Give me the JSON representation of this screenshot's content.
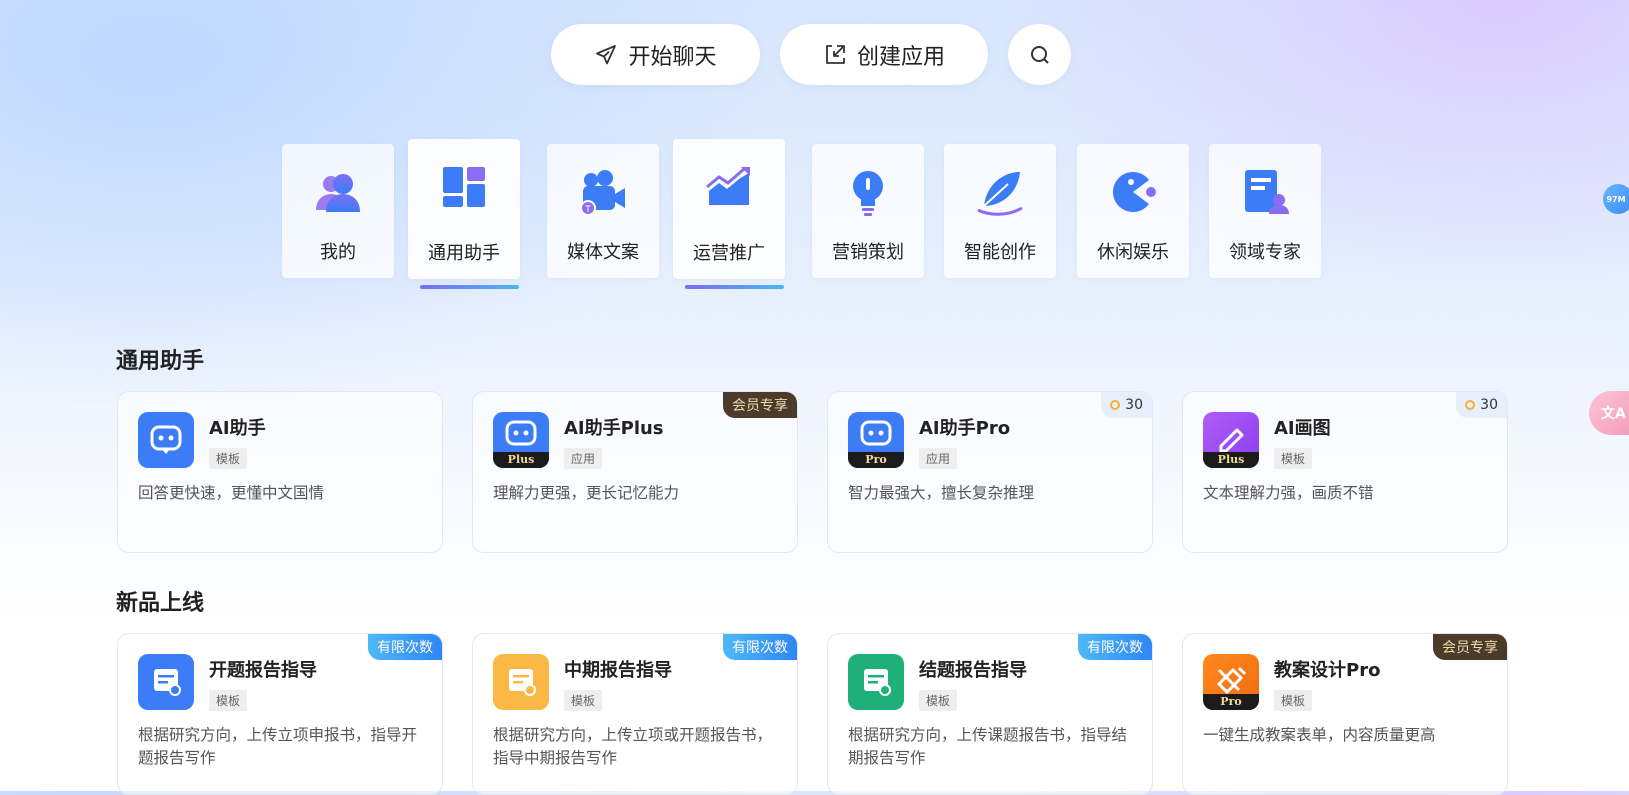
{
  "toolbar": {
    "chat_label": "开始聊天",
    "create_label": "创建应用",
    "chat_icon": "send-icon",
    "create_icon": "import-icon",
    "search_icon": "search-icon"
  },
  "categories": [
    {
      "label": "我的",
      "icon": "users-icon",
      "active": false
    },
    {
      "label": "通用助手",
      "icon": "layout-icon",
      "active": true
    },
    {
      "label": "媒体文案",
      "icon": "video-camera-icon",
      "active": false
    },
    {
      "label": "运营推广",
      "icon": "trend-chart-icon",
      "active": true
    },
    {
      "label": "营销策划",
      "icon": "lightbulb-icon",
      "active": false
    },
    {
      "label": "智能创作",
      "icon": "feather-icon",
      "active": false
    },
    {
      "label": "休闲娱乐",
      "icon": "pacman-icon",
      "active": false
    },
    {
      "label": "领域专家",
      "icon": "expert-document-icon",
      "active": false
    }
  ],
  "sections": [
    {
      "title": "通用助手",
      "cards": [
        {
          "name": "AI助手",
          "tag": "模板",
          "desc": "回答更快速，更懂中文国情",
          "badge": "",
          "icon": "chat-bot-icon",
          "icon_sub": ""
        },
        {
          "name": "AI助手Plus",
          "tag": "应用",
          "desc": "理解力更强，更长记忆能力",
          "badge": "会员专享",
          "icon": "chat-bot-icon",
          "icon_sub": "Plus"
        },
        {
          "name": "AI助手Pro",
          "tag": "应用",
          "desc": "智力最强大，擅长复杂推理",
          "points": "30",
          "icon": "chat-bot-icon",
          "icon_sub": "Pro"
        },
        {
          "name": "AI画图",
          "tag": "模板",
          "desc": "文本理解力强，画质不错",
          "points": "30",
          "icon": "pencil-icon",
          "icon_sub": "Plus"
        }
      ]
    },
    {
      "title": "新品上线",
      "cards": [
        {
          "name": "开题报告指导",
          "tag": "模板",
          "desc": "根据研究方向，上传立项申报书，指导开题报告写作",
          "badge": "有限次数",
          "icon": "report-icon"
        },
        {
          "name": "中期报告指导",
          "tag": "模板",
          "desc": "根据研究方向，上传立项或开题报告书，指导中期报告写作",
          "badge": "有限次数",
          "icon": "report-icon"
        },
        {
          "name": "结题报告指导",
          "tag": "模板",
          "desc": "根据研究方向，上传课题报告书，指导结期报告写作",
          "badge": "有限次数",
          "icon": "report-icon"
        },
        {
          "name": "教案设计Pro",
          "tag": "模板",
          "desc": "一键生成教案表单，内容质量更高",
          "badge": "会员专享",
          "icon": "pencil-ruler-icon",
          "icon_sub": "Pro"
        }
      ]
    }
  ],
  "floating": {
    "memory_label": "97M",
    "translate_label": "文A"
  },
  "colors": {
    "accent_blue": "#3c7cf6",
    "member_badge": "#4a3b2b",
    "limited_badge": "#2f86f6"
  }
}
